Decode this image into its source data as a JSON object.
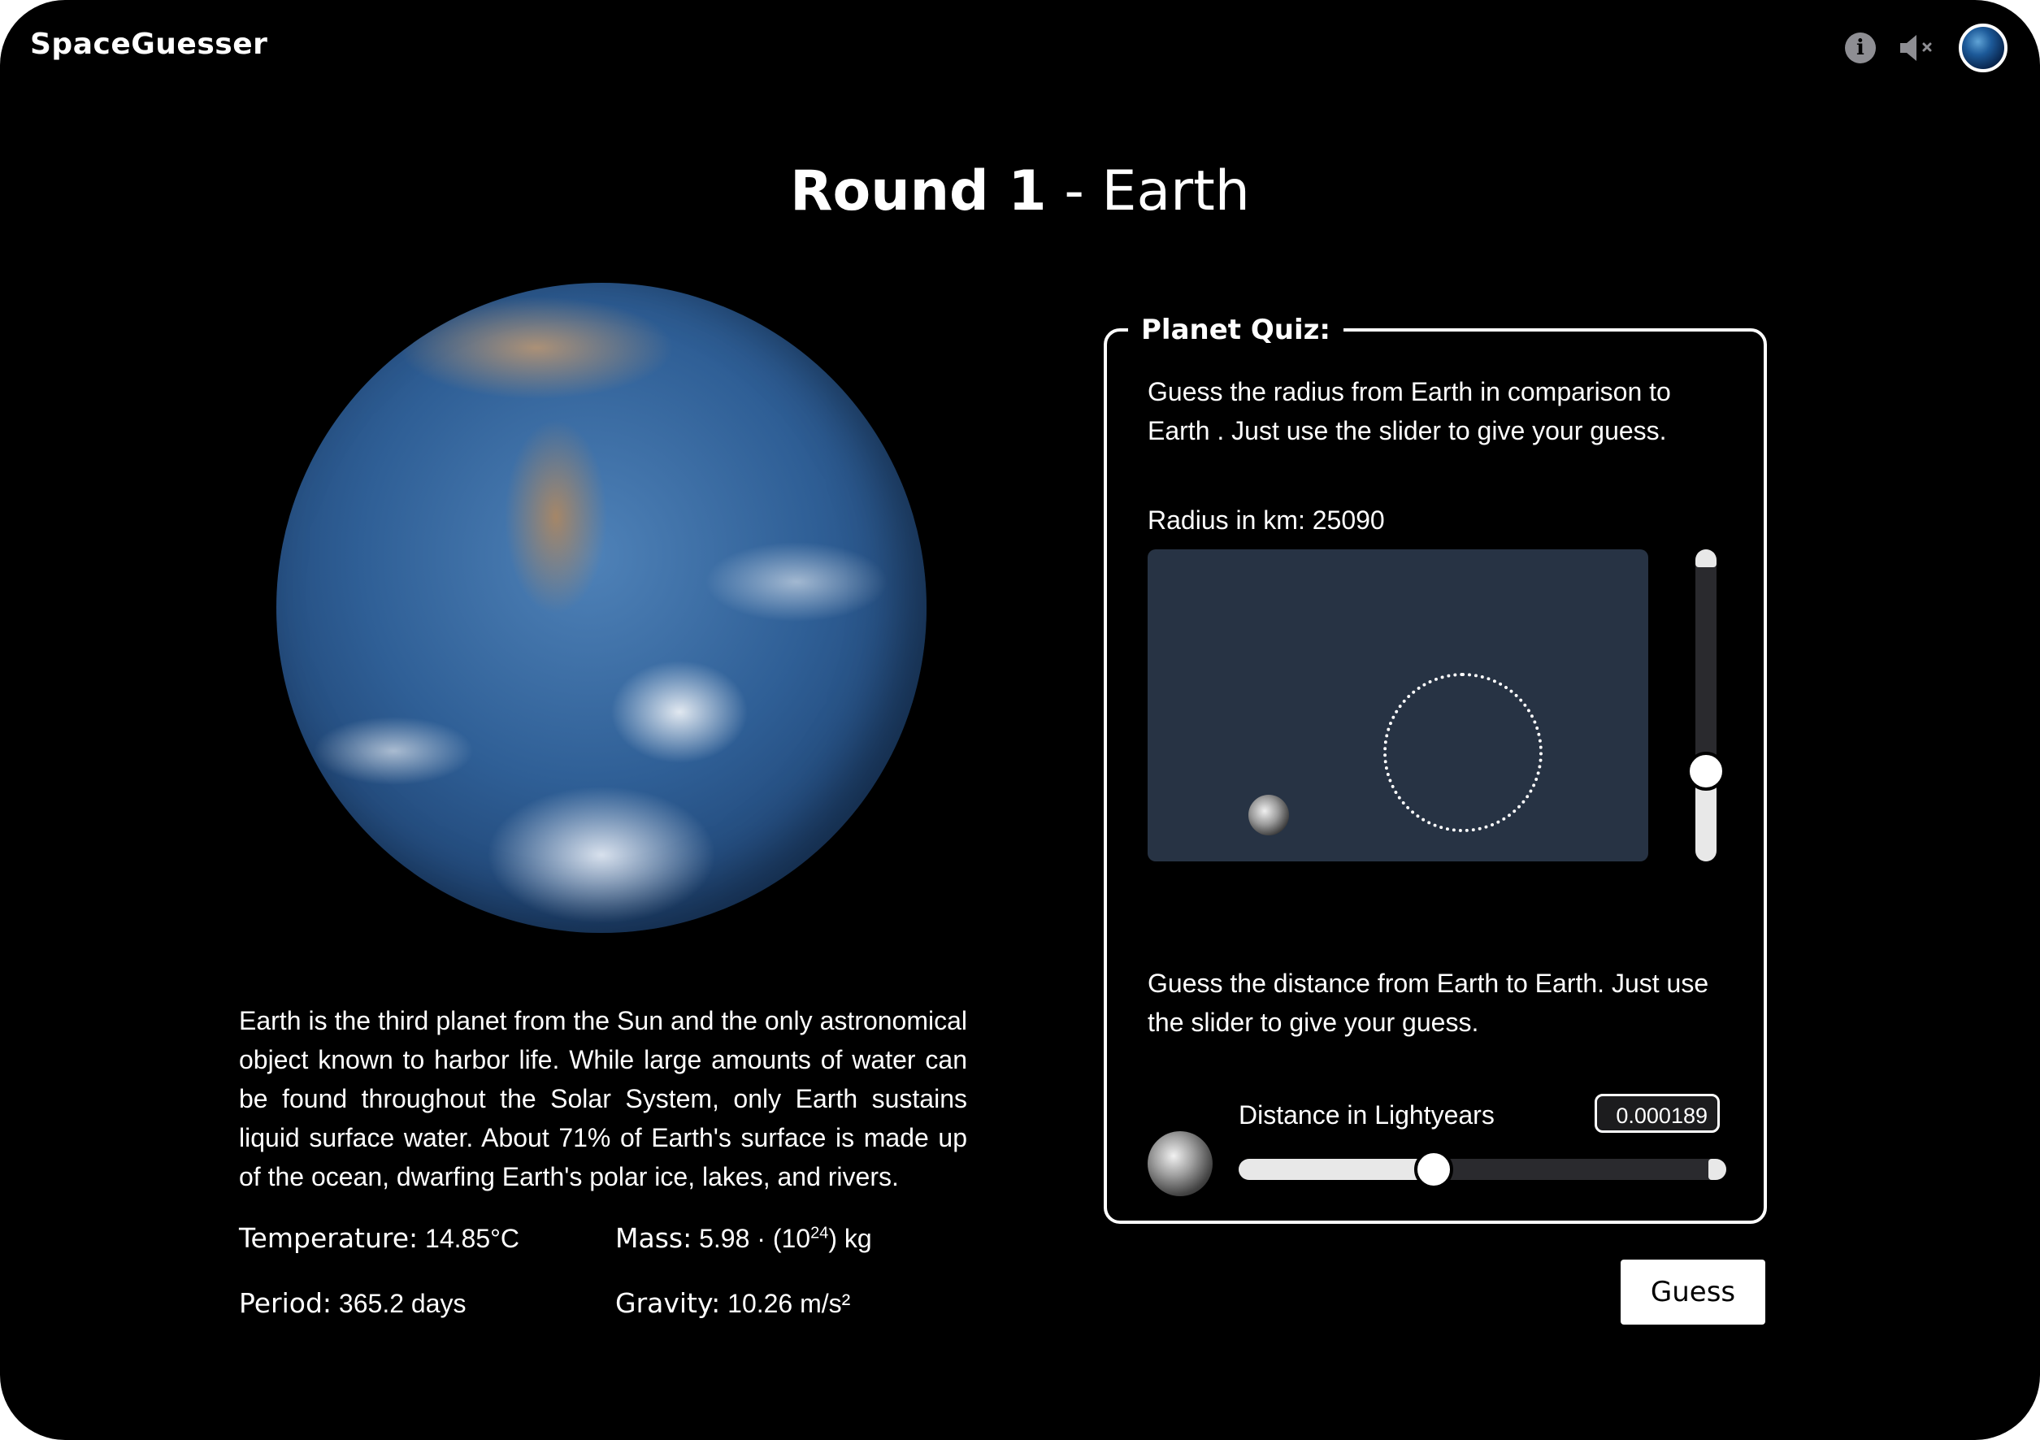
{
  "app": {
    "name": "SpaceGuesser"
  },
  "header": {
    "icons": [
      "info-icon",
      "sound-muted-icon",
      "planet-avatar-icon"
    ]
  },
  "title": {
    "round": "Round 1",
    "separator": " - ",
    "planet": "Earth"
  },
  "planet": {
    "name": "Earth",
    "description": "Earth is the third planet from the Sun and the only astronomical object known to harbor life. While large amounts of water can be found throughout the Solar System, only Earth sustains liquid surface water. About 71% of Earth's surface is made up of the ocean, dwarfing Earth's polar ice, lakes, and rivers.",
    "stats": {
      "temperature_label": "Temperature:",
      "temperature_value": "14.85°C",
      "mass_label": "Mass:",
      "mass_value_prefix": "5.98 · (10",
      "mass_value_exp": "24",
      "mass_value_suffix": ") kg",
      "period_label": "Period:",
      "period_value": "365.2 days",
      "gravity_label": "Gravity:",
      "gravity_value": "10.26 m/s²"
    }
  },
  "quiz": {
    "legend": "Planet Quiz:",
    "radius_question": "Guess the radius from Earth in comparison to Earth . Just use the slider to give your guess.",
    "radius_label": "Radius in km: 25090",
    "radius_slider_fraction": 0.29,
    "distance_question": "Guess the distance from Earth to Earth. Just use the slider to give your guess.",
    "distance_label": "Distance in Lightyears",
    "distance_value": "0.000189",
    "distance_slider_fraction": 0.4
  },
  "actions": {
    "guess_label": "Guess"
  },
  "colors": {
    "background": "#000000",
    "canvas": "#273344",
    "text": "#ffffff"
  }
}
